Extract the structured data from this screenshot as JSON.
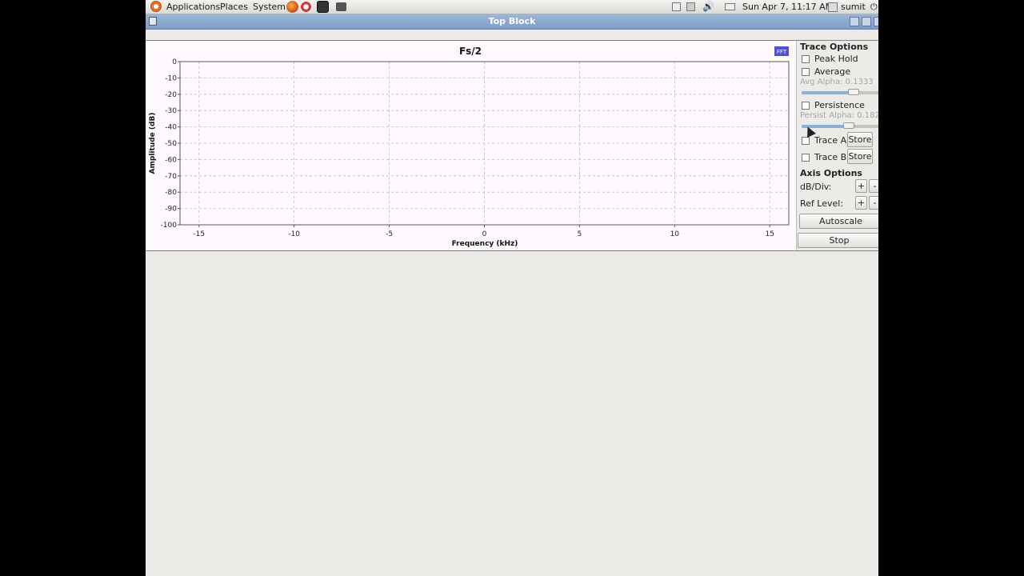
{
  "panel": {
    "menus": [
      "Applications",
      "Places",
      "System"
    ],
    "clock": "Sun Apr  7, 11:17 AM",
    "user": "sumit"
  },
  "window": {
    "title": "Top Block"
  },
  "chart_data": {
    "type": "line",
    "title": "Fs/2",
    "xlabel": "Frequency (kHz)",
    "ylabel": "Amplitude (dB)",
    "xlim": [
      -16,
      16
    ],
    "ylim": [
      -100,
      0
    ],
    "x_ticks": [
      -15,
      -10,
      -5,
      0,
      5,
      10,
      15
    ],
    "y_ticks": [
      0,
      -10,
      -20,
      -30,
      -40,
      -50,
      -60,
      -70,
      -80,
      -90,
      -100
    ],
    "grid": true,
    "series": [],
    "badge": "FFT",
    "colors": {
      "plot_bg": "#fffaff",
      "grid": "#b8b8c8",
      "badge": "#4e4ee6"
    }
  },
  "trace_options": {
    "heading": "Trace Options",
    "peak_hold": "Peak Hold",
    "average": "Average",
    "avg_alpha": "Avg Alpha: 0.1333",
    "avg_alpha_level": 0.68,
    "persistence": "Persistence",
    "persist_alpha": "Persist Alpha: 0.1821",
    "persist_alpha_level": 0.6,
    "trace_a": "Trace A",
    "trace_b": "Trace B",
    "store": "Store"
  },
  "axis_options": {
    "heading": "Axis Options",
    "db_div": "dB/Div:",
    "ref_level": "Ref Level:",
    "plus": "+",
    "minus": "-",
    "autoscale": "Autoscale"
  },
  "stop": "Stop"
}
